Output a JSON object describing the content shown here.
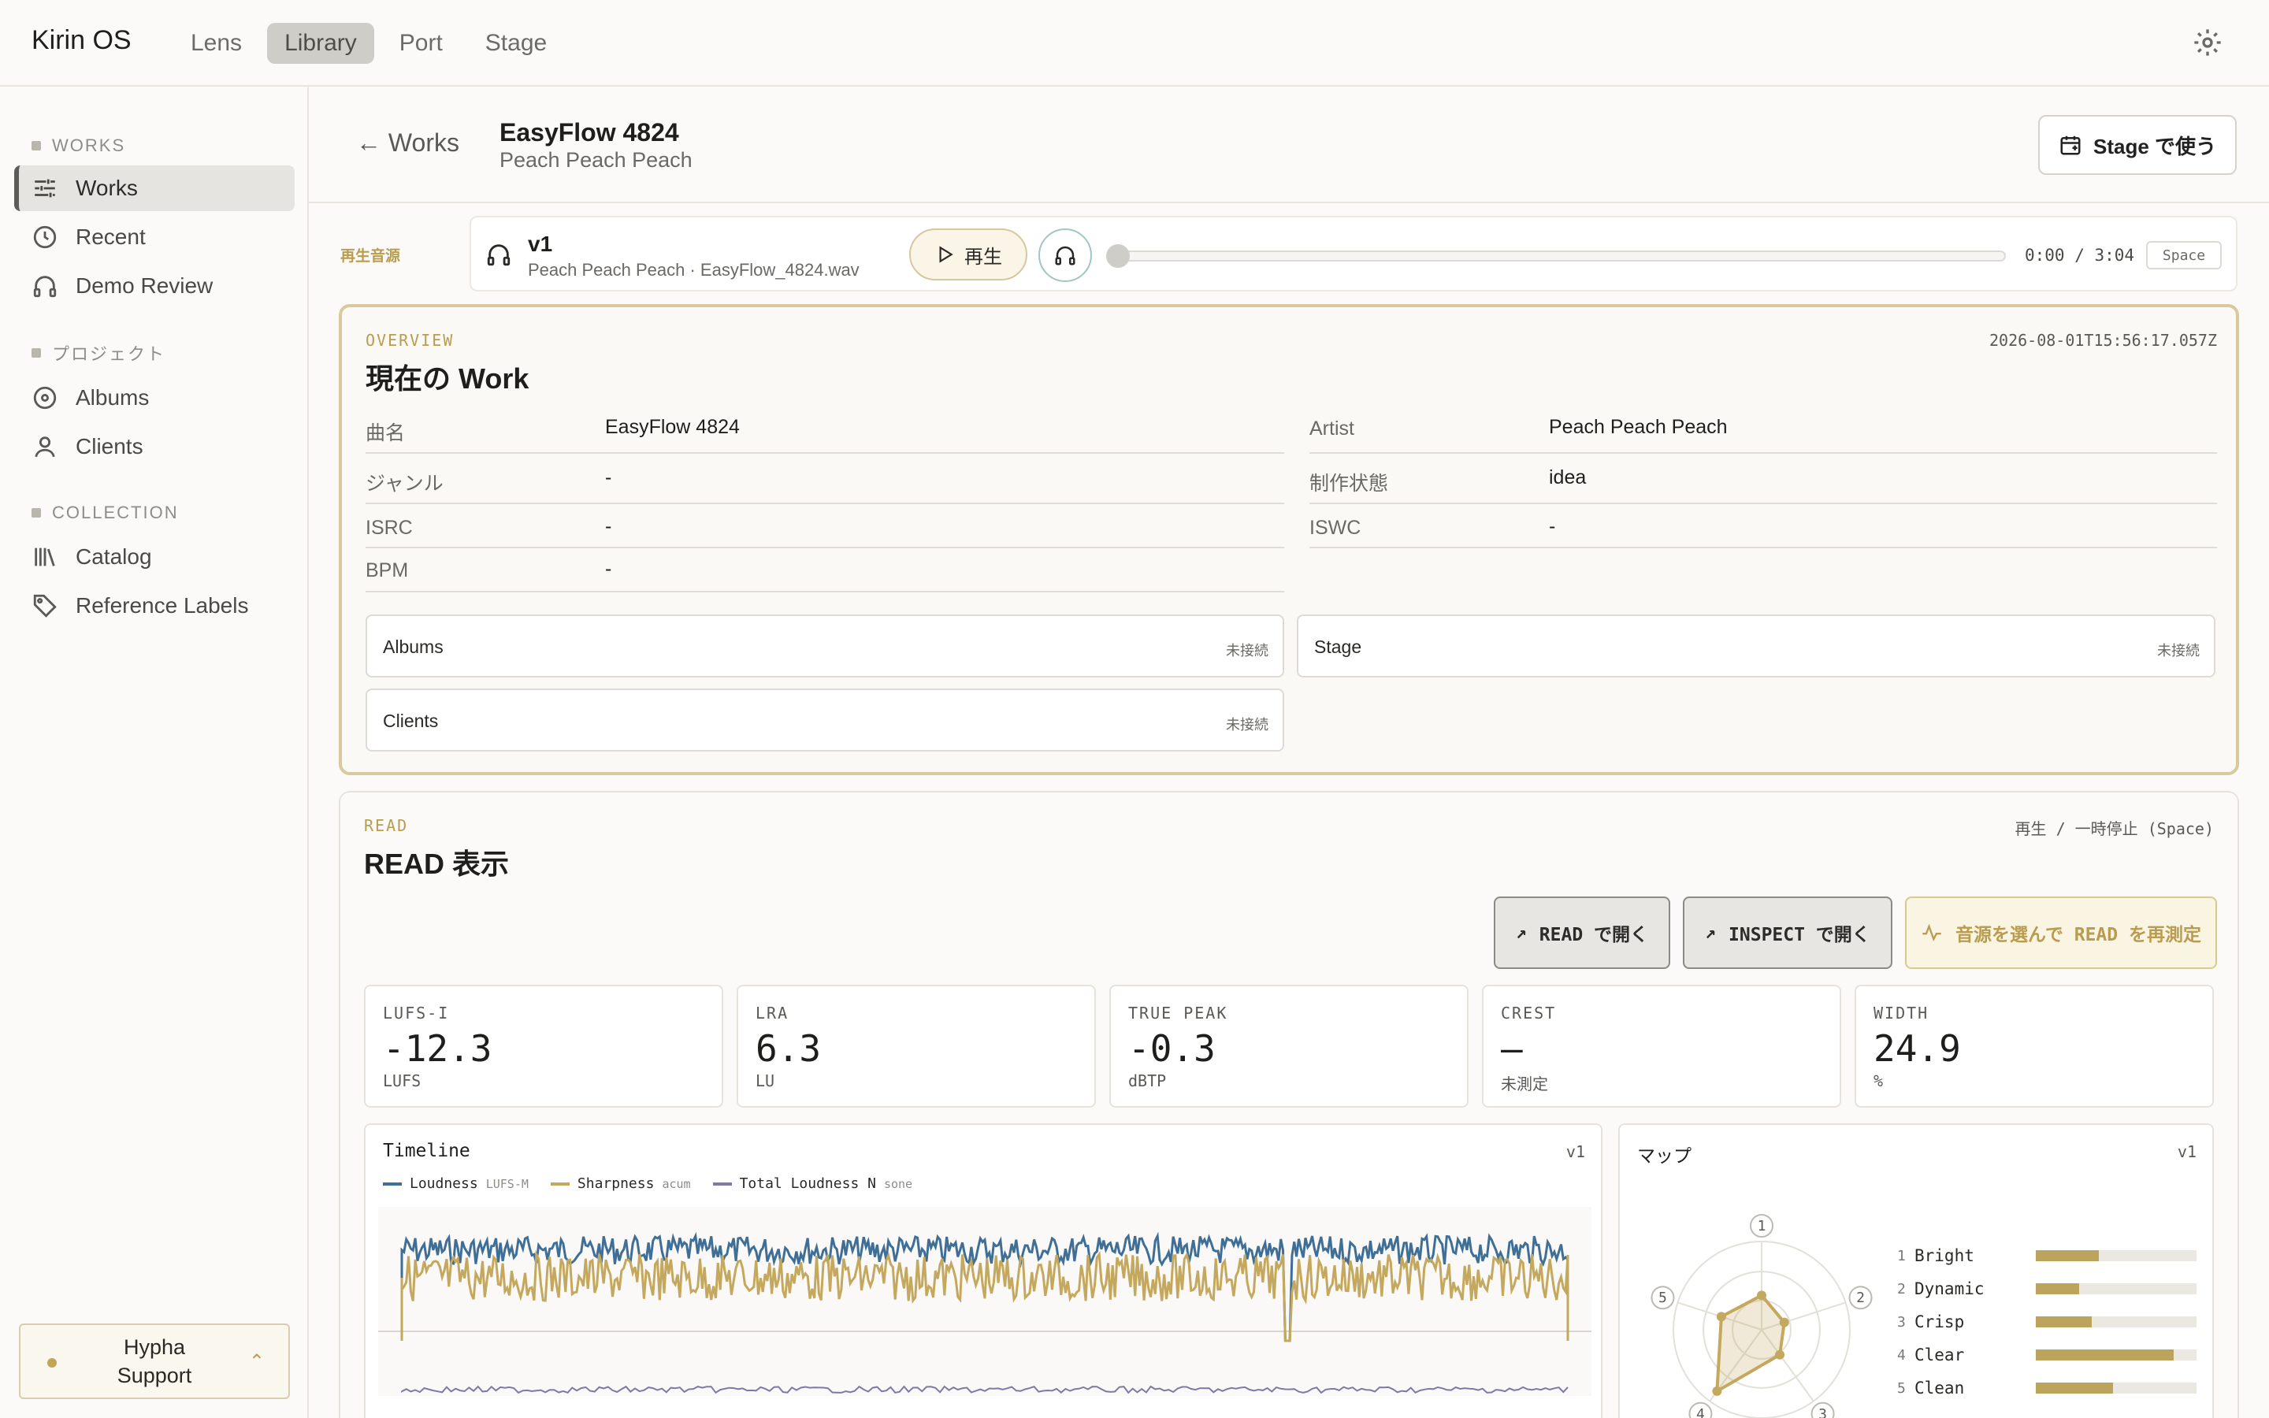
{
  "app": {
    "name": "Kirin OS"
  },
  "topnav": [
    {
      "label": "Lens",
      "active": false
    },
    {
      "label": "Library",
      "active": true
    },
    {
      "label": "Port",
      "active": false
    },
    {
      "label": "Stage",
      "active": false
    }
  ],
  "sidebar": {
    "sections": [
      {
        "label": "WORKS",
        "items": [
          {
            "label": "Works",
            "icon": "sliders-icon",
            "active": true
          },
          {
            "label": "Recent",
            "icon": "clock-icon"
          },
          {
            "label": "Demo Review",
            "icon": "headphones-icon"
          }
        ]
      },
      {
        "label": "プロジェクト",
        "items": [
          {
            "label": "Albums",
            "icon": "disc-icon"
          },
          {
            "label": "Clients",
            "icon": "user-icon"
          }
        ]
      },
      {
        "label": "COLLECTION",
        "items": [
          {
            "label": "Catalog",
            "icon": "library-icon"
          },
          {
            "label": "Reference Labels",
            "icon": "tag-icon"
          }
        ]
      }
    ],
    "support": {
      "line1": "Hypha",
      "line2": "Support",
      "chevron": "^"
    }
  },
  "header": {
    "back": "← Works",
    "title": "EasyFlow 4824",
    "subtitle": "Peach Peach Peach",
    "stage_button": "Stage で使う"
  },
  "player": {
    "source_label": "再生音源",
    "version": "v1",
    "file": "Peach Peach Peach · EasyFlow_4824.wav",
    "play_label": "再生",
    "time": "0:00 / 3:04",
    "key_hint": "Space",
    "progress": 0
  },
  "overview": {
    "kicker": "OVERVIEW",
    "title": "現在の Work",
    "timestamp": "2026-08-01T15:56:17.057Z",
    "left_fields": [
      {
        "key": "曲名",
        "value": "EasyFlow 4824"
      },
      {
        "key": "ジャンル",
        "value": "-"
      },
      {
        "key": "ISRC",
        "value": "-"
      },
      {
        "key": "BPM",
        "value": "-"
      }
    ],
    "right_fields": [
      {
        "key": "Artist",
        "value": "Peach Peach Peach"
      },
      {
        "key": "制作状態",
        "value": "idea"
      },
      {
        "key": "ISWC",
        "value": "-"
      }
    ],
    "links": [
      {
        "name": "Albums",
        "status": "未接続"
      },
      {
        "name": "Stage",
        "status": "未接続"
      },
      {
        "name": "Clients",
        "status": "未接続"
      }
    ]
  },
  "read": {
    "kicker": "READ",
    "title": "READ 表示",
    "hint": "再生 / 一時停止 (Space)",
    "actions": [
      {
        "label": "READ で開く"
      },
      {
        "label": "INSPECT で開く"
      },
      {
        "label": "音源を選んで READ を再測定"
      }
    ],
    "metrics": [
      {
        "label": "LUFS-I",
        "value": "-12.3",
        "unit": "LUFS"
      },
      {
        "label": "LRA",
        "value": "6.3",
        "unit": "LU"
      },
      {
        "label": "TRUE PEAK",
        "value": "-0.3",
        "unit": "dBTP"
      },
      {
        "label": "CREST",
        "value": "—",
        "unit": "未測定"
      },
      {
        "label": "WIDTH",
        "value": "24.9",
        "unit": "%"
      }
    ],
    "timeline": {
      "title": "Timeline",
      "version": "v1",
      "legend": [
        {
          "name": "Loudness",
          "unit": "LUFS-M",
          "color": "#3f6f96"
        },
        {
          "name": "Sharpness",
          "unit": "acum",
          "color": "#c4a85e"
        },
        {
          "name": "Total Loudness N",
          "unit": "sone",
          "color": "#7d7aa6"
        }
      ]
    },
    "map": {
      "title": "マップ",
      "version": "v1",
      "axes": [
        {
          "index": "1",
          "name": "Bright",
          "value": 0.39
        },
        {
          "index": "2",
          "name": "Dynamic",
          "value": 0.27
        },
        {
          "index": "3",
          "name": "Crisp",
          "value": 0.35
        },
        {
          "index": "4",
          "name": "Clear",
          "value": 0.86
        },
        {
          "index": "5",
          "name": "Clean",
          "value": 0.48
        }
      ]
    }
  },
  "colors": {
    "accent": "#b99c4f",
    "loudness": "#3f6f96",
    "sharpness": "#c4a85e",
    "total": "#7d7aa6"
  }
}
